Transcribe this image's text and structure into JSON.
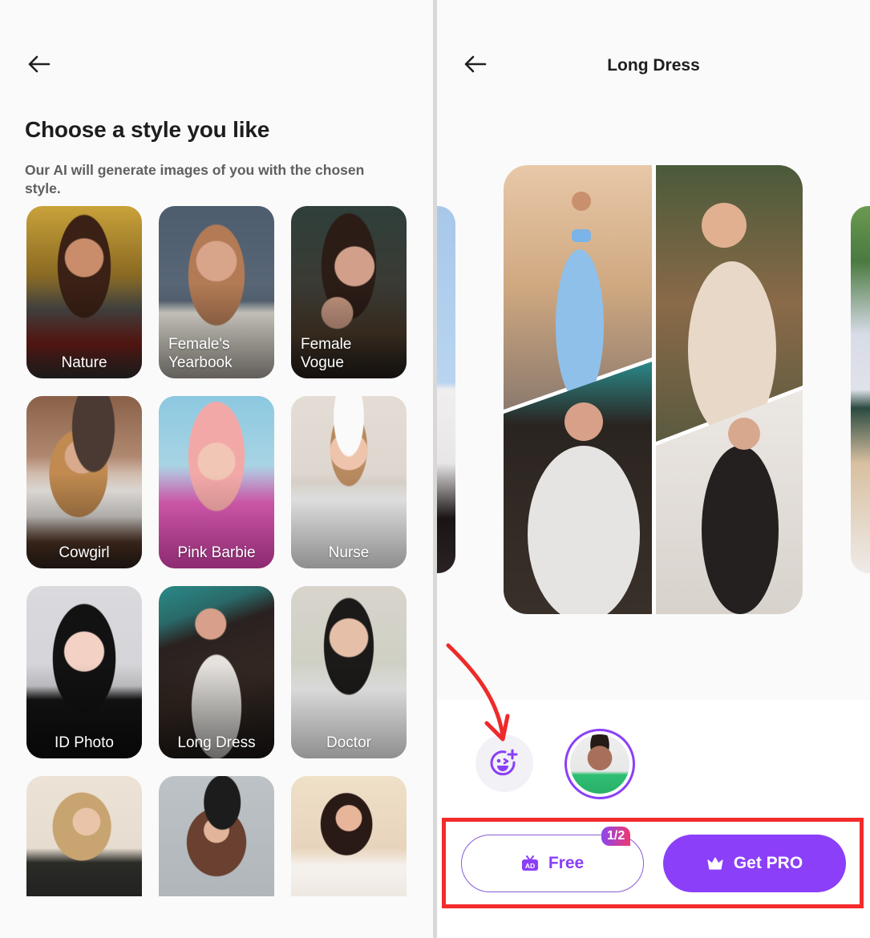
{
  "style_picker": {
    "back_icon": "arrow-left-icon",
    "title": "Choose a style you like",
    "subtitle": "Our AI will generate images of you with the chosen style.",
    "styles": [
      {
        "label": "Nature",
        "label_align": "center"
      },
      {
        "label": "Female's Yearbook",
        "label_align": "left"
      },
      {
        "label": "Female Vogue",
        "label_align": "left"
      },
      {
        "label": "Cowgirl",
        "label_align": "center"
      },
      {
        "label": "Pink Barbie",
        "label_align": "center"
      },
      {
        "label": "Nurse",
        "label_align": "center"
      },
      {
        "label": "ID Photo",
        "label_align": "center"
      },
      {
        "label": "Long Dress",
        "label_align": "center"
      },
      {
        "label": "Doctor",
        "label_align": "center"
      },
      {
        "label": "",
        "label_align": "center"
      },
      {
        "label": "",
        "label_align": "center"
      },
      {
        "label": "",
        "label_align": "center"
      }
    ]
  },
  "style_detail": {
    "back_icon": "arrow-left-icon",
    "title": "Long Dress",
    "preview_images": [
      "blue-two-piece-gown",
      "lace-plunge-gown",
      "white-tulle-dress",
      "black-midi-dress"
    ],
    "add_face_icon": "face-add-icon",
    "selected_face": "male-avatar",
    "free_button": {
      "label": "Free",
      "icon": "ad-tv-icon",
      "badge": "1/2"
    },
    "pro_button": {
      "label": "Get PRO",
      "icon": "crown-icon"
    },
    "colors": {
      "accent": "#8b3ff8",
      "highlight": "#f42b2b"
    }
  }
}
